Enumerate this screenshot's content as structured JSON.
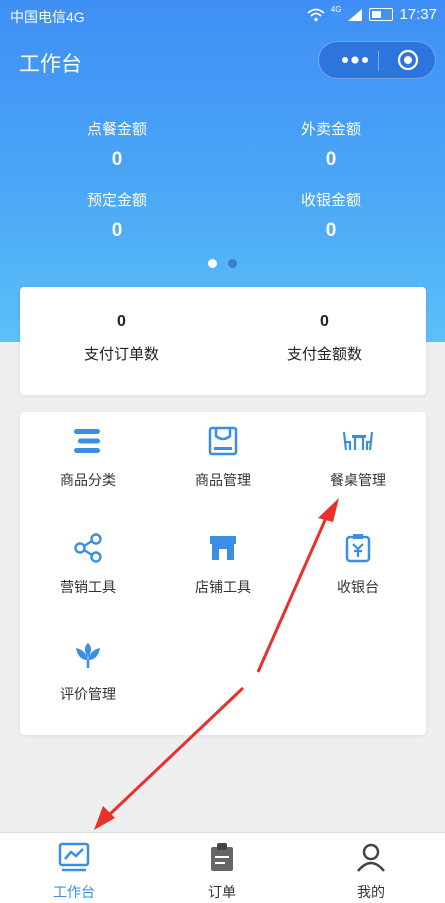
{
  "status_bar": {
    "carrier": "中国电信4G",
    "network": "4G",
    "time": "17:37"
  },
  "header": {
    "title": "工作台"
  },
  "stats": [
    {
      "label": "点餐金额",
      "value": "0"
    },
    {
      "label": "外卖金额",
      "value": "0"
    },
    {
      "label": "预定金额",
      "value": "0"
    },
    {
      "label": "收银金额",
      "value": "0"
    }
  ],
  "pager": {
    "pages": 2,
    "active": 1
  },
  "summary": [
    {
      "label": "支付订单数",
      "value": "0"
    },
    {
      "label": "支付金额数",
      "value": "0"
    }
  ],
  "tools": [
    {
      "label": "商品分类",
      "icon": "category-icon"
    },
    {
      "label": "商品管理",
      "icon": "product-icon"
    },
    {
      "label": "餐桌管理",
      "icon": "table-icon"
    },
    {
      "label": "营销工具",
      "icon": "share-icon"
    },
    {
      "label": "店铺工具",
      "icon": "store-icon"
    },
    {
      "label": "收银台",
      "icon": "cashier-icon"
    },
    {
      "label": "评价管理",
      "icon": "flower-icon"
    }
  ],
  "tabbar": [
    {
      "label": "工作台",
      "icon": "dashboard-icon",
      "active": true
    },
    {
      "label": "订单",
      "icon": "order-icon",
      "active": false
    },
    {
      "label": "我的",
      "icon": "user-icon",
      "active": false
    }
  ],
  "colors": {
    "primary": "#3f8ef5",
    "icon_blue": "#3a8ee6",
    "arrow_red": "#e8312a",
    "active_tab": "#3a8ee6",
    "inactive_tab": "#333333"
  }
}
